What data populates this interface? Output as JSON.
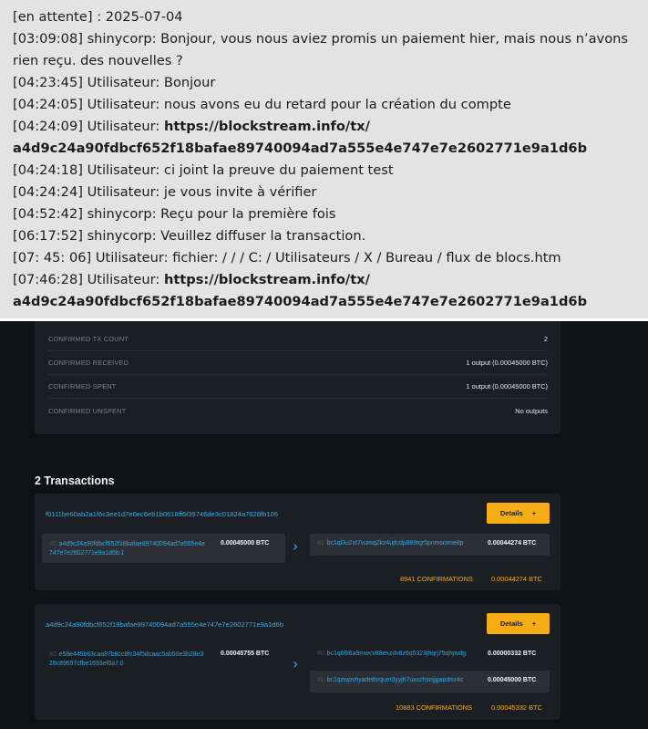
{
  "chat": [
    {
      "type": "plain",
      "text": "[en attente] : 2025-07-04"
    },
    {
      "type": "plain",
      "wrap": true,
      "text": "[03:09:08] shinycorp: Bonjour, vous nous aviez promis un paiement hier, mais nous n’avons rien reçu. des nouvelles ?"
    },
    {
      "type": "plain",
      "text": "[04:23:45] Utilisateur: Bonjour"
    },
    {
      "type": "plain",
      "text": "[04:24:05] Utilisateur: nous avons eu du retard pour la création du compte"
    },
    {
      "type": "link",
      "prefix": "[04:24:09] Utilisateur: ",
      "link1": "https://blockstream.info/tx/",
      "link2": "a4d9c24a90fdbcf652f18bafae89740094ad7a555e4e747e7e2602771e9a1d6b"
    },
    {
      "type": "plain",
      "text": "[04:24:18] Utilisateur: ci joint la preuve du paiement test"
    },
    {
      "type": "plain",
      "text": "[04:24:24] Utilisateur: je vous invite à vérifier"
    },
    {
      "type": "plain",
      "text": "[04:52:42] shinycorp: Reçu pour la première fois"
    },
    {
      "type": "plain",
      "text": "[06:17:52] shinycorp: Veuillez diffuser la transaction."
    },
    {
      "type": "plain",
      "text": "[07: 45: 06] Utilisateur: fichier: / / / C: / Utilisateurs / X / Bureau / flux de blocs.htm"
    },
    {
      "type": "link",
      "prefix": "[07:46:28] Utilisateur: ",
      "link1": "https://blockstream.info/tx/",
      "link2": "a4d9c24a90fdbcf652f18bafae89740094ad7a555e4e747e7e2602771e9a1d6b"
    }
  ],
  "stats": [
    {
      "label": "CONFIRMED TX COUNT",
      "value": "2"
    },
    {
      "label": "CONFIRMED RECEIVED",
      "value": "1 output (0.00045000 BTC)"
    },
    {
      "label": "CONFIRMED SPENT",
      "value": "1 output (0.00045000 BTC)"
    },
    {
      "label": "CONFIRMED UNSPENT",
      "value": "No outputs"
    }
  ],
  "transactions_heading": "2 Transactions",
  "details_label": "Details",
  "details_plus": "+",
  "arrow_glyph": "›",
  "tx1": {
    "id": "f0111be60ab2a1f6c3ee1d7e0ec6eb1b0618ff6f39746de3c01824a7628fb105",
    "input_index": "#0",
    "input_addr_line1": "a4d9c24a90fdbcf652f18bafae89740094ad7a555e4e",
    "input_addr_line2": "747e7e2602771e9a1d6b:1",
    "input_amount": "0.00045000 BTC",
    "output_index": "#0",
    "output_addr": "bc1ql3u2xt7vumq2kz4ujtcdp889tqr5pnmscene8p",
    "output_amount": "0.00044274 BTC",
    "confirmations": "8941 CONFIRMATIONS",
    "total": "0.00044274 BTC"
  },
  "tx2": {
    "id": "a4d9c24a90fdbcf652f18bafae89740094ad7a555e4e747e7e2602771e9a1d6b",
    "input_index": "#0",
    "input_addr_line1": "e58e445b63caa87b8cc8fc34f5dcaac5ab50e3b28e3",
    "input_addr_line2": "28c89697cfbe1693ef0a7:0",
    "input_amount": "0.00045755 BTC",
    "output1_index": "#0",
    "output1_addr": "bc1q6l96a9mwcv88exzdv8z6q5323jhqrj75qhpvdg",
    "output1_amount": "0.00000332 BTC",
    "output2_index": "#1",
    "output2_addr": "bc1qzwpshyadethrqum0yyjh7uxxzhsnjjgapdmr4c",
    "output2_amount": "0.00045000 BTC",
    "confirmations": "10883 CONFIRMATIONS",
    "total": "0.00045332 BTC"
  }
}
